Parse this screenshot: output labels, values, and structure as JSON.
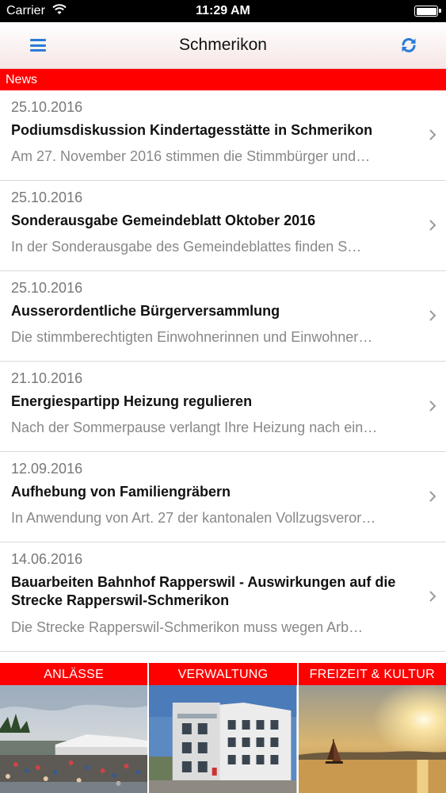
{
  "status_bar": {
    "carrier": "Carrier",
    "time": "11:29 AM"
  },
  "nav": {
    "title": "Schmerikon",
    "menu_icon": "hamburger-menu-icon",
    "refresh_icon": "refresh-icon",
    "accent": "#2a7bd6"
  },
  "section": {
    "title": "News",
    "color": "#ff0000"
  },
  "news": [
    {
      "date": "25.10.2016",
      "title": "Podiumsdiskussion Kindertagesstätte in Schmerikon",
      "teaser": "Am 27. November 2016 stimmen die Stimmbürger und…"
    },
    {
      "date": "25.10.2016",
      "title": "Sonderausgabe Gemeindeblatt Oktober 2016",
      "teaser": "In der Sonderausgabe des Gemeindeblattes finden S…"
    },
    {
      "date": "25.10.2016",
      "title": "Ausserordentliche Bürgerversammlung",
      "teaser": "Die stimmberechtigten Einwohnerinnen und Einwohner…"
    },
    {
      "date": "21.10.2016",
      "title": "Energiespartipp Heizung regulieren",
      "teaser": "Nach der Sommerpause verlangt Ihre Heizung nach ein…"
    },
    {
      "date": "12.09.2016",
      "title": "Aufhebung von Familiengräbern",
      "teaser": "In Anwendung von Art. 27 der kantonalen Vollzugsveror…"
    },
    {
      "date": "14.06.2016",
      "title": "Bauarbeiten Bahnhof Rapperswil - Auswirkungen auf die Strecke Rapperswil-Schmerikon",
      "teaser": "Die Strecke Rapperswil-Schmerikon muss wegen Arb…"
    }
  ],
  "tiles": [
    {
      "label": "ANLÄSSE"
    },
    {
      "label": "VERWALTUNG"
    },
    {
      "label": "FREIZEIT & KULTUR"
    }
  ]
}
